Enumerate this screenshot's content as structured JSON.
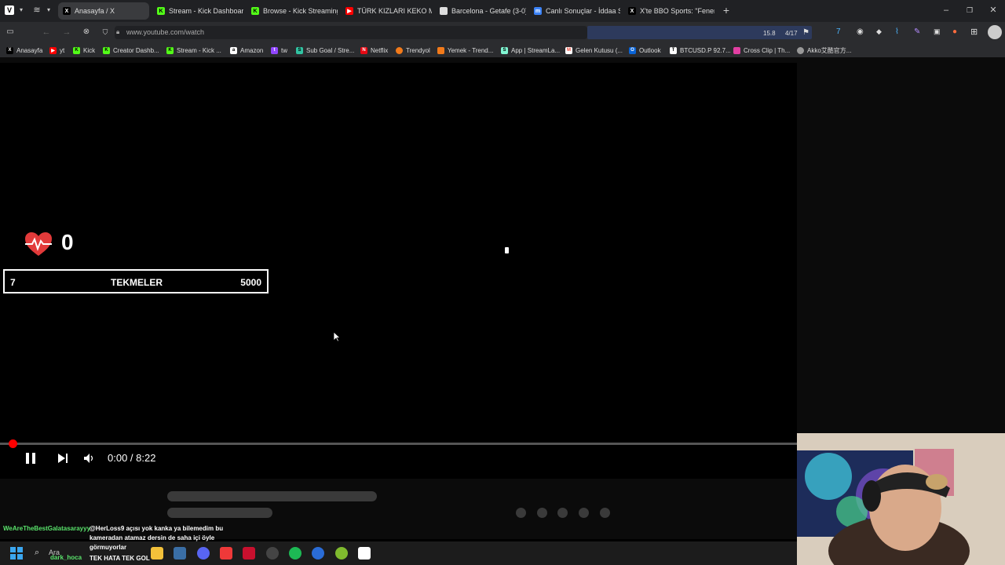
{
  "browser": {
    "tabs": [
      {
        "label": "Anasayfa / X",
        "icon": "x-logo",
        "active": true
      },
      {
        "label": "Stream - Kick Dashboard",
        "icon": "kick-logo"
      },
      {
        "label": "Browse - Kick Streaming",
        "icon": "kick-logo"
      },
      {
        "label": "TÜRK KIZLARI KEKO MU SE",
        "icon": "youtube-logo"
      },
      {
        "label": "Barcelona - Getafe (3-0) - I",
        "icon": "document"
      },
      {
        "label": "Canlı Sonuçlar - İddaa Sonu",
        "icon": "m-logo"
      },
      {
        "label": "X'te BBO Sports: \"Fenerbah",
        "icon": "x-logo"
      }
    ],
    "url": "www.youtube.com/watch",
    "find_zoom": "15.8",
    "find_count": "4/17",
    "bookmarks": [
      {
        "label": "Anasayfa",
        "icon": "x-logo"
      },
      {
        "label": "yt",
        "icon": "youtube-logo"
      },
      {
        "label": "Kick",
        "icon": "kick-logo"
      },
      {
        "label": "Creator Dashb...",
        "icon": "kick-logo"
      },
      {
        "label": "Stream - Kick ...",
        "icon": "kick-logo"
      },
      {
        "label": "Amazon",
        "icon": "amazon-logo"
      },
      {
        "label": "tw",
        "icon": "twitch-logo"
      },
      {
        "label": "Sub Goal / Stre...",
        "icon": "streamlabs-logo"
      },
      {
        "label": "Netflix",
        "icon": "netflix-logo"
      },
      {
        "label": "Trendyol",
        "icon": "trendyol-logo"
      },
      {
        "label": "Yemek - Trend...",
        "icon": "trendyol-logo"
      },
      {
        "label": "App | StreamLa...",
        "icon": "streamlabs-logo"
      },
      {
        "label": "Gelen Kutusu (...",
        "icon": "gmail-logo"
      },
      {
        "label": "Outlook",
        "icon": "outlook-logo"
      },
      {
        "label": "BTCUSD.P 92.7...",
        "icon": "tradingview-logo"
      },
      {
        "label": "Cross Clip | Th...",
        "icon": "crossclip-logo"
      },
      {
        "label": "Akko艾酷官方...",
        "icon": "akko-logo"
      }
    ]
  },
  "overlay": {
    "heart_count": "0",
    "goal_current": "7",
    "goal_label": "TEKMELER",
    "goal_target": "5000"
  },
  "player": {
    "time": "0:00 / 8:22",
    "progress": 0.0
  },
  "chat": {
    "user1": "WeAreTheBestGalatasarayyy",
    "msg1_line1": "@HerLoss9 açısı yok kanka ya bilemedim bu",
    "msg1_line2": "kameradan atamaz dersin de saha içi öyle",
    "msg1_line3": "görmuyorlar",
    "user2": "dark_hoca",
    "msg2": "TEK HATA TEK GOL"
  },
  "taskbar": {
    "search_label": "Ara"
  }
}
